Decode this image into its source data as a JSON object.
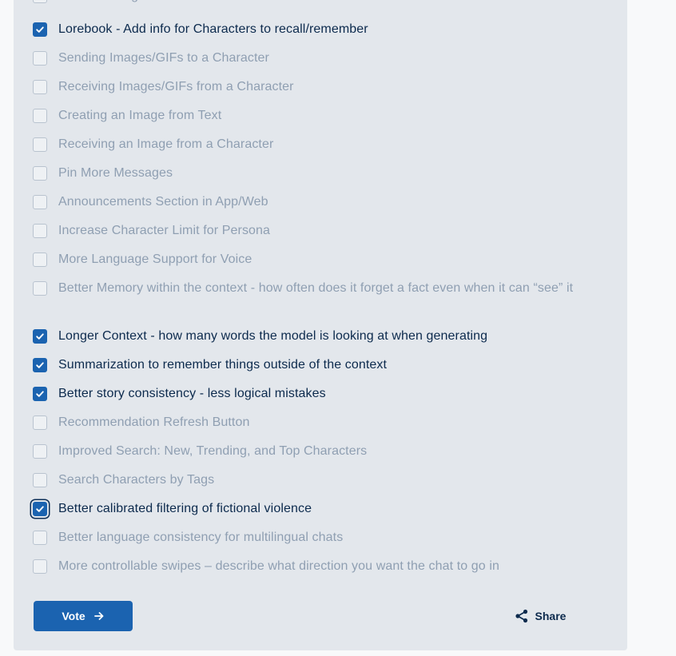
{
  "options": [
    {
      "label": "Folders to organize Personas",
      "checked": false
    },
    {
      "label": "Lorebook - Add info for Characters to recall/remember",
      "checked": true
    },
    {
      "label": "Sending Images/GIFs to a Character",
      "checked": false
    },
    {
      "label": "Receiving Images/GIFs from a Character",
      "checked": false
    },
    {
      "label": "Creating an Image from Text",
      "checked": false
    },
    {
      "label": "Receiving an Image from a Character",
      "checked": false
    },
    {
      "label": "Pin More Messages",
      "checked": false
    },
    {
      "label": "Announcements Section in App/Web",
      "checked": false
    },
    {
      "label": "Increase Character Limit for Persona",
      "checked": false
    },
    {
      "label": "More Language Support for Voice",
      "checked": false
    },
    {
      "label": "Better Memory within the context - how often does it forget a fact even when it can “see” it",
      "checked": false
    },
    {
      "label": "Longer Context - how many words the model is looking at when generating",
      "checked": true
    },
    {
      "label": "Summarization to remember things outside of the context",
      "checked": true
    },
    {
      "label": "Better story consistency - less logical mistakes",
      "checked": true
    },
    {
      "label": "Recommendation Refresh Button",
      "checked": false
    },
    {
      "label": "Improved Search: New, Trending, and Top Characters",
      "checked": false
    },
    {
      "label": "Search Characters by Tags",
      "checked": false
    },
    {
      "label": "Better calibrated filtering of fictional violence",
      "checked": true,
      "focused": true
    },
    {
      "label": "Better language consistency for multilingual chats",
      "checked": false
    },
    {
      "label": "More controllable swipes – describe what direction you want the chat to go in",
      "checked": false
    }
  ],
  "vote_button": {
    "label": "Vote",
    "icon": "arrow-right-icon"
  },
  "share_button": {
    "label": "Share",
    "icon": "share-icon"
  },
  "colors": {
    "accent": "#1b63b0",
    "checked_text": "#0c2a4d",
    "unchecked_text": "#8f9fb2",
    "panel_bg": "#e3e7ec"
  }
}
